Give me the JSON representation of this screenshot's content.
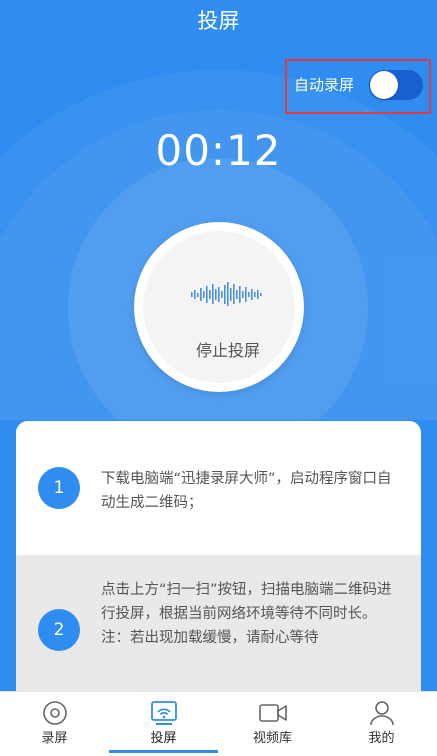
{
  "header": {
    "title": "投屏"
  },
  "auto_record": {
    "label": "自动录屏",
    "enabled": true
  },
  "timer": {
    "value": "00:12"
  },
  "stop_button": {
    "label": "停止投屏"
  },
  "steps": [
    {
      "number": "1",
      "text": "下载电脑端“迅捷录屏大师”，启动程序窗口自动生成二维码；"
    },
    {
      "number": "2",
      "text": "点击上方“扫一扫”按钮，扫描电脑端二维码进行投屏，根据当前网络环境等待不同时长。 注：若出现加载缓慢，请耐心等待"
    }
  ],
  "tabs": [
    {
      "label": "录屏",
      "icon": "record-icon",
      "active": false
    },
    {
      "label": "投屏",
      "icon": "cast-icon",
      "active": true
    },
    {
      "label": "视频库",
      "icon": "video-icon",
      "active": false
    },
    {
      "label": "我的",
      "icon": "user-icon",
      "active": false
    }
  ],
  "colors": {
    "primary": "#2f8cf0",
    "toggle_on": "#1a5fce",
    "highlight_border": "#e23a3f"
  }
}
